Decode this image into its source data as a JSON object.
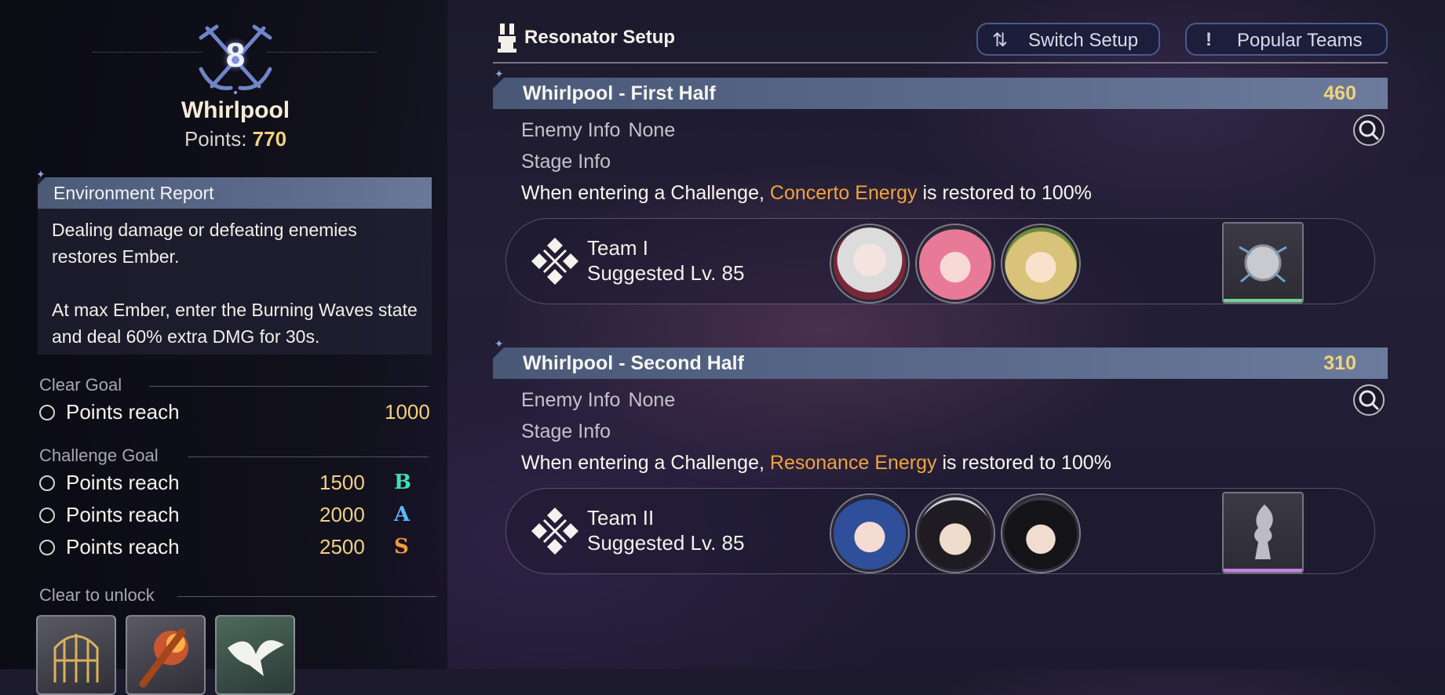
{
  "left": {
    "stage_number": "8",
    "stage_name": "Whirlpool",
    "points_label": "Points:",
    "points_value": "770",
    "environment": {
      "title": "Environment Report",
      "text1": "Dealing damage or defeating enemies restores Ember.",
      "text2": "At max Ember, enter the Burning Waves state and deal 60% extra DMG for 30s."
    },
    "clear_goal": {
      "title": "Clear Goal",
      "rows": [
        {
          "label": "Points reach",
          "value": "1000"
        }
      ]
    },
    "challenge_goal": {
      "title": "Challenge Goal",
      "rows": [
        {
          "label": "Points reach",
          "value": "1500",
          "rank": "B",
          "rank_color": "#3fe0b4"
        },
        {
          "label": "Points reach",
          "value": "2000",
          "rank": "A",
          "rank_color": "#5ab8ff"
        },
        {
          "label": "Points reach",
          "value": "2500",
          "rank": "S",
          "rank_color": "#f59a3a"
        }
      ]
    },
    "unlock": {
      "title": "Clear to unlock",
      "items": [
        {
          "icon": "birdcage-icon"
        },
        {
          "icon": "fire-staff-icon"
        },
        {
          "icon": "white-dove-icon"
        }
      ]
    }
  },
  "header": {
    "title": "Resonator Setup",
    "switch_label": "Switch Setup",
    "popular_label": "Popular Teams"
  },
  "halves": [
    {
      "title": "Whirlpool - First Half",
      "points": "460",
      "enemy_label": "Enemy Info",
      "enemy_value": "None",
      "stage_label": "Stage Info",
      "desc_pre": "When entering a Challenge,",
      "desc_hl": "Concerto Energy",
      "desc_post": "is restored to 100%",
      "team": {
        "name": "Team I",
        "level": "Suggested Lv. 85",
        "echo_color": "#6fd48f"
      }
    },
    {
      "title": "Whirlpool - Second Half",
      "points": "310",
      "enemy_label": "Enemy Info",
      "enemy_value": "None",
      "stage_label": "Stage Info",
      "desc_pre": "When entering a Challenge,",
      "desc_hl": "Resonance Energy",
      "desc_post": "is restored to 100%",
      "team": {
        "name": "Team II",
        "level": "Suggested Lv. 85",
        "echo_color": "#c87ee8"
      }
    }
  ],
  "colors": {
    "accent_gold": "#f2d27c",
    "highlight_orange": "#f4a23e",
    "bar_blue": "#5d6c8d"
  }
}
